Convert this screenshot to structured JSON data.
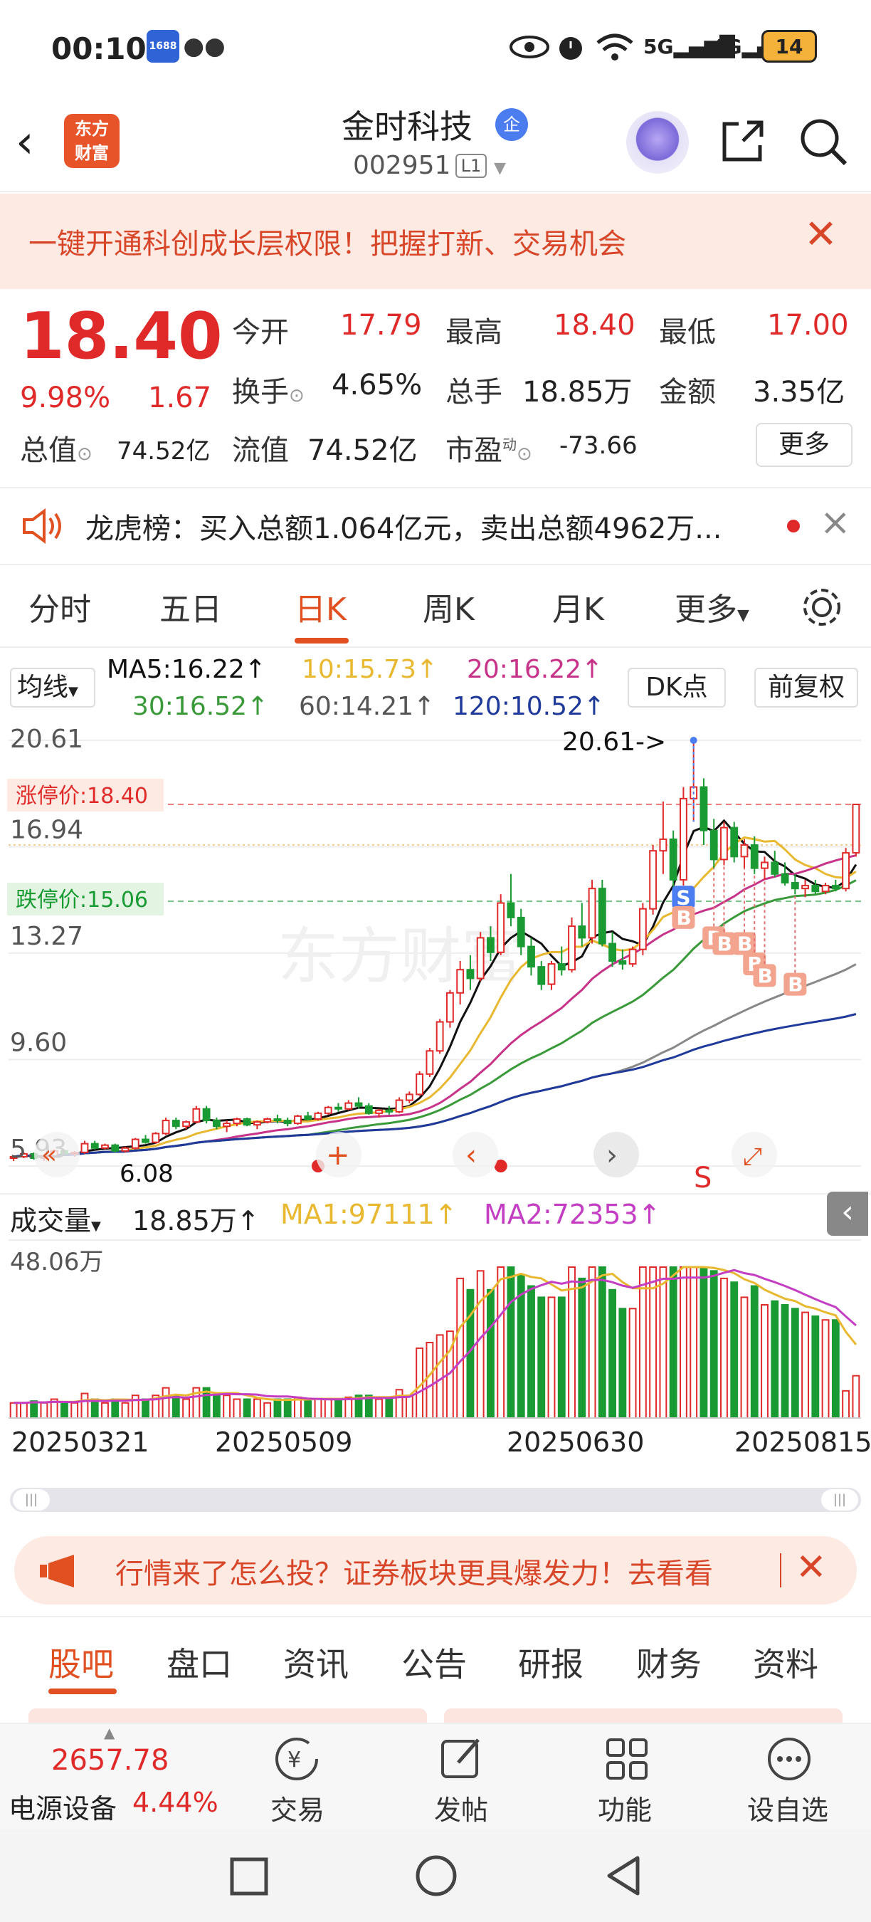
{
  "status_bar": {
    "time": "00:10",
    "battery": "14",
    "signal1": "5G",
    "signal2": "4G",
    "app_badge": "1688"
  },
  "header": {
    "stock_name": "金时科技",
    "stock_code": "002951",
    "level": "L1",
    "logo_text_1": "东方",
    "logo_text_2": "财富",
    "corp_badge": "企"
  },
  "banner": {
    "text": "一键开通科创成长层权限！把握打新、交易机会",
    "close": "✕"
  },
  "quote": {
    "price": "18.40",
    "change_pct": "9.98%",
    "change": "1.67",
    "market_cap_label": "总值",
    "market_cap": "74.52亿",
    "open_label": "今开",
    "open": "17.79",
    "high_label": "最高",
    "high": "18.40",
    "low_label": "最低",
    "low": "17.00",
    "turnover_label": "换手",
    "turnover": "4.65%",
    "volume_label": "总手",
    "volume": "18.85万",
    "amount_label": "金额",
    "amount": "3.35亿",
    "float_label": "流值",
    "float_cap": "74.52亿",
    "pe_label": "市盈",
    "pe_sup": "动",
    "pe": "-73.66",
    "more": "更多"
  },
  "dragon_tiger": {
    "text": "龙虎榜：买入总额1.064亿元，卖出总额4962万..."
  },
  "chart_tabs": {
    "items": [
      "分时",
      "五日",
      "日K",
      "周K",
      "月K",
      "更多"
    ],
    "active": "日K"
  },
  "ma_row": {
    "selector": "均线",
    "ma5": "MA5:16.22↑",
    "ma10": "10:15.73↑",
    "ma20": "20:16.22↑",
    "ma30": "30:16.52↑",
    "ma60": "60:14.21↑",
    "ma120": "120:10.52↑",
    "dk": "DK点",
    "fuquan": "前复权"
  },
  "kline": {
    "y_labels": [
      "20.61",
      "16.94",
      "13.27",
      "9.60",
      "5.93"
    ],
    "high_marker": "20.61->",
    "low_marker": "6.08",
    "limit_up_label": "涨停价:18.40",
    "limit_down_label": "跌停价:15.06",
    "watermark": "东方财富",
    "trade_markers": {
      "sell": "S",
      "buy": "B"
    }
  },
  "volume": {
    "selector": "成交量",
    "total": "18.85万↑",
    "ma1": "MA1:97111↑",
    "ma2": "MA2:72353↑",
    "max_label": "48.06万",
    "dates": [
      "20250321",
      "20250509",
      "20250630",
      "20250815"
    ]
  },
  "ad": {
    "text": "行情来了怎么投？证券板块更具爆发力！去看看",
    "close": "✕"
  },
  "bottom_tabs": {
    "items": [
      "股吧",
      "盘口",
      "资讯",
      "公告",
      "研报",
      "财务",
      "资料"
    ],
    "active": "股吧"
  },
  "toolbar": {
    "index_value": "2657.78",
    "index_name": "电源设备",
    "index_pct": "4.44%",
    "trade": "交易",
    "post": "发帖",
    "features": "功能",
    "watchlist": "设自选"
  },
  "colors": {
    "up": "#e02a2a",
    "down": "#1a9a33",
    "accent": "#e05020",
    "ma5": "#111111",
    "ma10": "#e8b830",
    "ma20": "#c8338a",
    "ma30": "#3a9a3a",
    "ma60": "#888888",
    "ma120": "#1f3a9a"
  },
  "chart_data": {
    "type": "candlestick",
    "ylim": [
      5.93,
      20.61
    ],
    "x_tick_labels": [
      "20250321",
      "20250509",
      "20250630",
      "20250815"
    ],
    "candles": [
      [
        6.2,
        6.3,
        6.1,
        6.25
      ],
      [
        6.25,
        6.4,
        6.2,
        6.35
      ],
      [
        6.35,
        6.4,
        6.15,
        6.2
      ],
      [
        6.2,
        6.3,
        6.1,
        6.28
      ],
      [
        6.28,
        6.5,
        6.2,
        6.45
      ],
      [
        6.45,
        6.5,
        6.3,
        6.35
      ],
      [
        6.35,
        6.45,
        6.25,
        6.4
      ],
      [
        6.4,
        6.8,
        6.35,
        6.7
      ],
      [
        6.7,
        6.8,
        6.5,
        6.55
      ],
      [
        6.55,
        6.7,
        6.5,
        6.65
      ],
      [
        6.65,
        6.7,
        6.4,
        6.45
      ],
      [
        6.45,
        6.6,
        6.4,
        6.55
      ],
      [
        6.55,
        6.9,
        6.5,
        6.85
      ],
      [
        6.85,
        7.0,
        6.7,
        6.75
      ],
      [
        6.75,
        7.1,
        6.7,
        7.05
      ],
      [
        7.05,
        7.6,
        7.0,
        7.5
      ],
      [
        7.5,
        7.6,
        7.2,
        7.3
      ],
      [
        7.3,
        7.5,
        7.2,
        7.45
      ],
      [
        7.45,
        8.0,
        7.4,
        7.9
      ],
      [
        7.9,
        8.0,
        7.4,
        7.5
      ],
      [
        7.5,
        7.6,
        7.2,
        7.3
      ],
      [
        7.3,
        7.5,
        7.1,
        7.4
      ],
      [
        7.4,
        7.6,
        7.3,
        7.55
      ],
      [
        7.55,
        7.6,
        7.3,
        7.35
      ],
      [
        7.35,
        7.5,
        7.2,
        7.45
      ],
      [
        7.45,
        7.6,
        7.4,
        7.55
      ],
      [
        7.55,
        7.7,
        7.4,
        7.5
      ],
      [
        7.5,
        7.6,
        7.3,
        7.4
      ],
      [
        7.4,
        7.7,
        7.35,
        7.65
      ],
      [
        7.65,
        7.8,
        7.5,
        7.55
      ],
      [
        7.55,
        7.8,
        7.5,
        7.75
      ],
      [
        7.75,
        8.0,
        7.7,
        7.95
      ],
      [
        7.95,
        8.1,
        7.8,
        7.9
      ],
      [
        7.9,
        8.2,
        7.85,
        8.1
      ],
      [
        8.1,
        8.3,
        7.9,
        8.0
      ],
      [
        8.0,
        8.1,
        7.7,
        7.75
      ],
      [
        7.75,
        7.9,
        7.6,
        7.85
      ],
      [
        7.85,
        8.0,
        7.7,
        7.8
      ],
      [
        7.8,
        8.3,
        7.75,
        8.2
      ],
      [
        8.2,
        8.5,
        8.1,
        8.4
      ],
      [
        8.4,
        9.2,
        8.35,
        9.1
      ],
      [
        9.1,
        10.0,
        9.0,
        9.9
      ],
      [
        9.9,
        11.0,
        9.8,
        10.9
      ],
      [
        10.9,
        12.0,
        10.7,
        11.9
      ],
      [
        11.9,
        13.0,
        11.5,
        12.7
      ],
      [
        12.7,
        13.2,
        12.0,
        12.4
      ],
      [
        12.4,
        14.0,
        12.3,
        13.8
      ],
      [
        13.8,
        14.2,
        13.0,
        13.3
      ],
      [
        13.3,
        15.3,
        13.2,
        15.0
      ],
      [
        15.0,
        16.0,
        14.2,
        14.5
      ],
      [
        14.5,
        14.8,
        13.2,
        13.5
      ],
      [
        13.5,
        13.8,
        12.5,
        12.8
      ],
      [
        12.8,
        13.0,
        12.0,
        12.2
      ],
      [
        12.2,
        13.0,
        12.0,
        12.9
      ],
      [
        12.9,
        13.5,
        12.5,
        12.7
      ],
      [
        12.7,
        14.5,
        12.6,
        14.2
      ],
      [
        14.2,
        15.0,
        13.5,
        13.8
      ],
      [
        13.8,
        15.8,
        13.6,
        15.5
      ],
      [
        15.5,
        15.8,
        13.5,
        13.6
      ],
      [
        13.6,
        14.0,
        12.8,
        13.0
      ],
      [
        13.0,
        13.4,
        12.7,
        12.9
      ],
      [
        12.9,
        13.5,
        12.8,
        13.4
      ],
      [
        13.4,
        15.0,
        13.2,
        14.8
      ],
      [
        14.8,
        17.0,
        14.6,
        16.8
      ],
      [
        16.8,
        18.5,
        16.0,
        17.2
      ],
      [
        17.2,
        17.5,
        15.5,
        15.8
      ],
      [
        15.8,
        19.0,
        15.6,
        18.6
      ],
      [
        18.6,
        20.61,
        17.8,
        19.0
      ],
      [
        19.0,
        19.3,
        17.0,
        17.5
      ],
      [
        17.5,
        17.9,
        16.2,
        16.5
      ],
      [
        16.5,
        17.8,
        16.3,
        17.6
      ],
      [
        17.6,
        17.8,
        16.4,
        16.6
      ],
      [
        16.6,
        17.2,
        16.2,
        17.0
      ],
      [
        17.0,
        17.3,
        16.0,
        16.2
      ],
      [
        16.2,
        16.6,
        15.8,
        16.4
      ],
      [
        16.4,
        16.8,
        15.9,
        16.0
      ],
      [
        16.0,
        16.4,
        15.6,
        15.7
      ],
      [
        15.7,
        16.0,
        15.3,
        15.5
      ],
      [
        15.5,
        15.8,
        15.2,
        15.6
      ],
      [
        15.6,
        15.8,
        15.3,
        15.4
      ],
      [
        15.4,
        15.7,
        15.3,
        15.6
      ],
      [
        15.6,
        15.8,
        15.4,
        15.5
      ],
      [
        15.5,
        16.9,
        15.4,
        16.73
      ],
      [
        16.73,
        18.4,
        16.6,
        18.4
      ]
    ],
    "volume_max": 480600
  }
}
